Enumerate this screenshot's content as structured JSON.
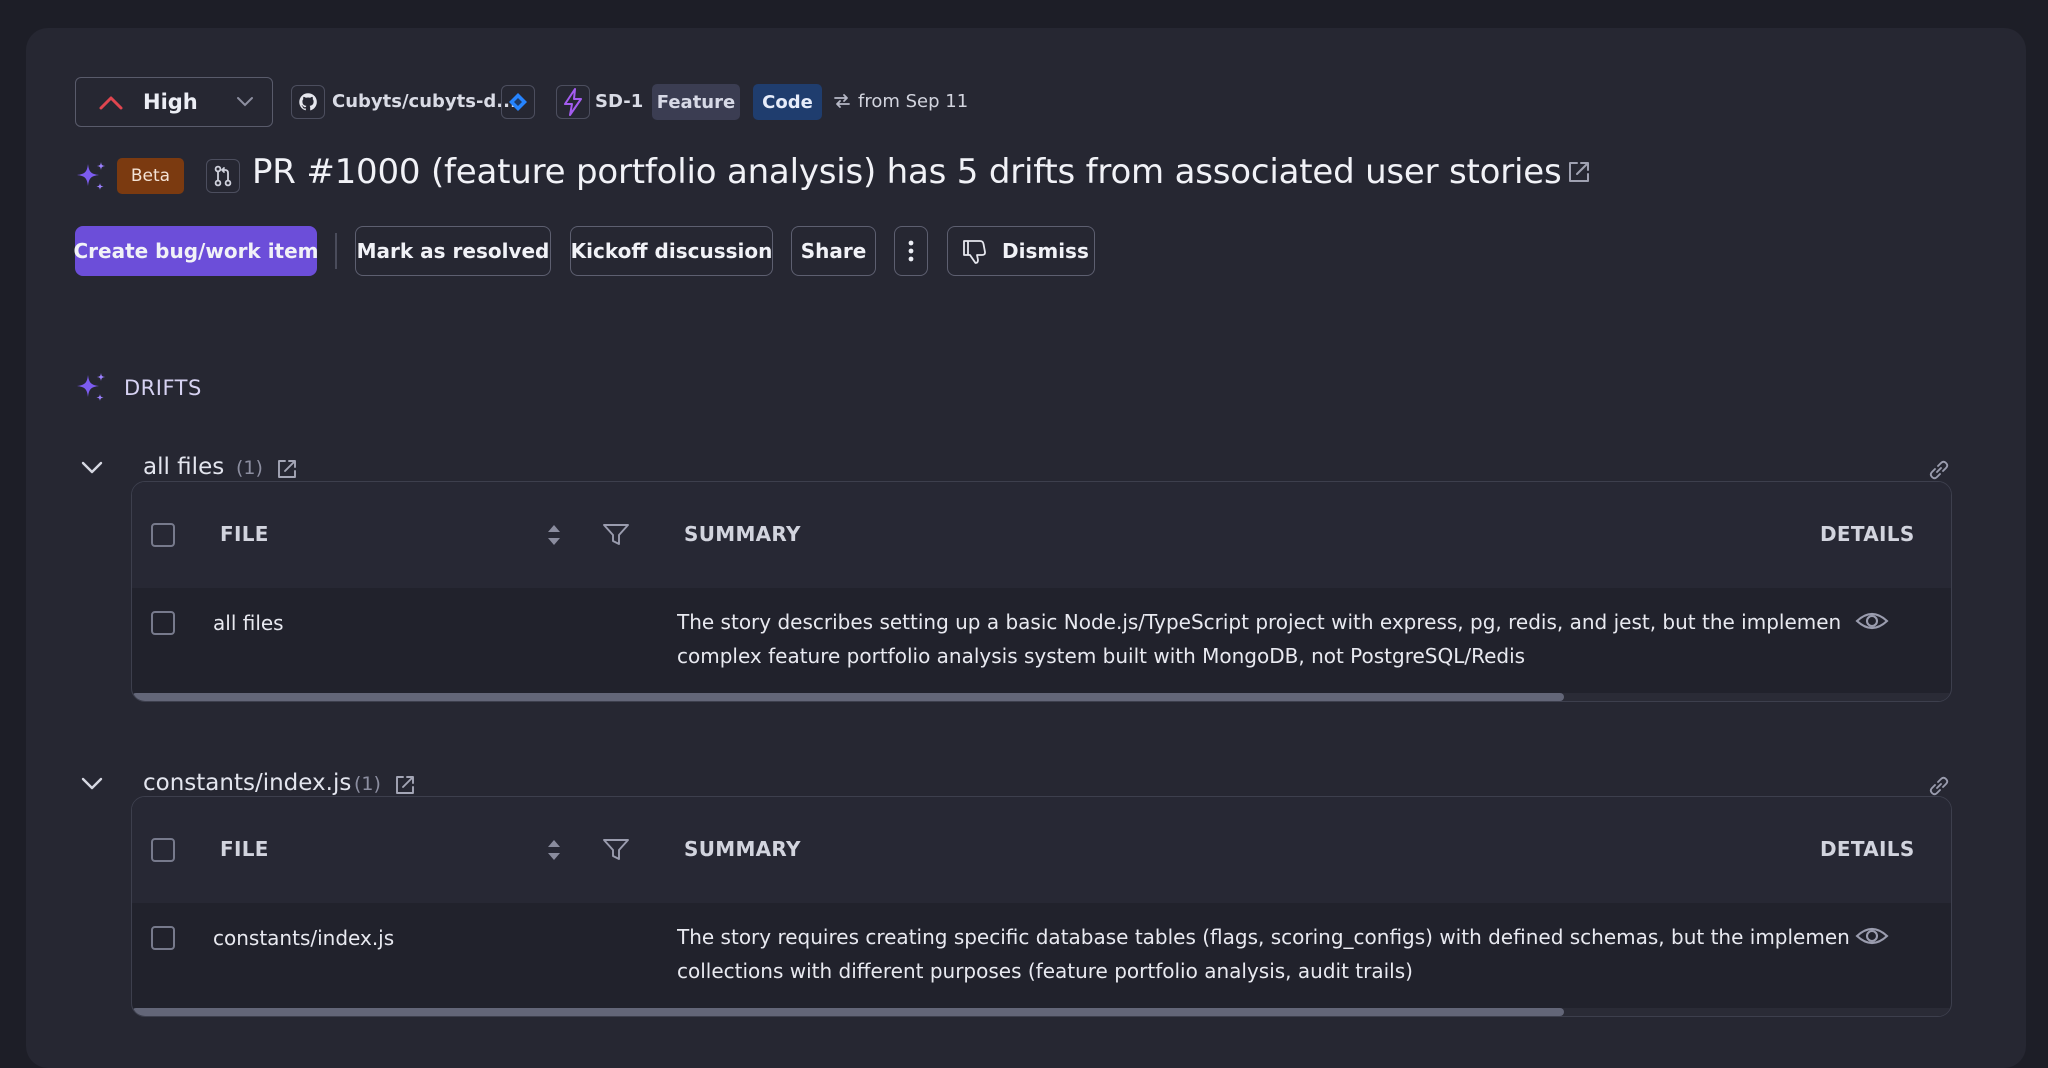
{
  "header": {
    "priority": "High",
    "repo": "Cubyts/cubyts-d...",
    "ticket": "SD-1",
    "tag_feature": "Feature",
    "tag_code": "Code",
    "since": "from Sep 11"
  },
  "title": {
    "badge": "Beta",
    "text": "PR #1000 (feature portfolio analysis) has 5 drifts from associated user stories"
  },
  "actions": {
    "create": "Create bug/work item",
    "resolve": "Mark as resolved",
    "kickoff": "Kickoff discussion",
    "share": "Share",
    "dismiss": "Dismiss"
  },
  "section": {
    "label": "DRIFTS"
  },
  "columns": {
    "file": "FILE",
    "summary": "SUMMARY",
    "details": "DETAILS"
  },
  "groups": [
    {
      "title": "all files",
      "count": "(1)",
      "row": {
        "file": "all files",
        "summary_line1": "The story describes setting up a basic Node.js/TypeScript project with express, pg, redis, and jest, but the implemen",
        "summary_line2": "complex feature portfolio analysis system built with MongoDB, not PostgreSQL/Redis"
      }
    },
    {
      "title": "constants/index.js",
      "count": "(1)",
      "row": {
        "file": "constants/index.js",
        "summary_line1": "The story requires creating specific database tables (flags, scoring_configs) with defined schemas, but the implemen",
        "summary_line2": "collections with different purposes (feature portfolio analysis, audit trails)"
      }
    }
  ],
  "colors": {
    "background": "#1d1e27",
    "panel": "#262732",
    "primary": "#6c4ed9",
    "beta": "#7b3a10",
    "feature_tag": "#3b3d52",
    "code_tag": "#1f3d6e",
    "priority_high": "#e0454f",
    "sparkle": "#7c5cf0"
  }
}
